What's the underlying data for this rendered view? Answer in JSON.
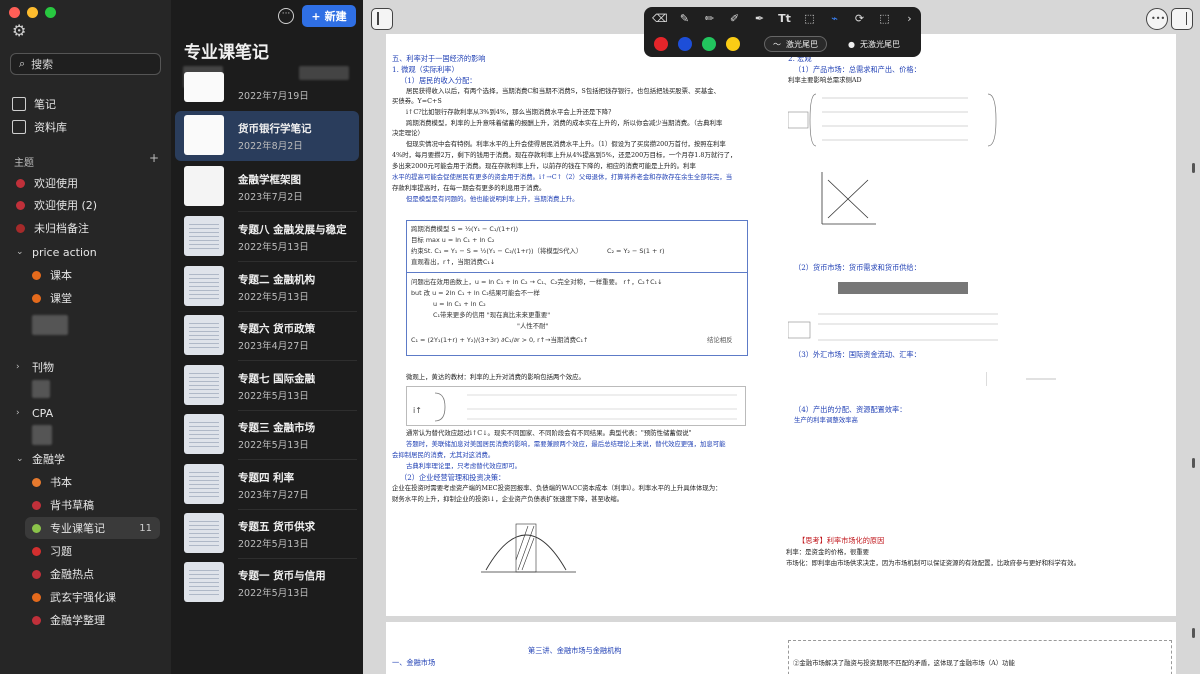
{
  "sidebar": {
    "search_placeholder": "搜索",
    "nav": {
      "notes": "笔记",
      "library": "资料库"
    },
    "section_title": "主题",
    "topics": [
      {
        "label": "欢迎使用",
        "color": "#c0303a"
      },
      {
        "label": "欢迎使用 (2)",
        "color": "#c0303a"
      },
      {
        "label": "未归档备注",
        "color": "#a52a2a"
      }
    ],
    "groups": [
      {
        "label": "price action",
        "expanded": true,
        "children": [
          {
            "label": "课本",
            "color": "#e46a1c"
          },
          {
            "label": "课堂",
            "color": "#e46a1c"
          }
        ]
      },
      {
        "label": "刊物",
        "expanded": false,
        "children": []
      },
      {
        "label": "CPA",
        "expanded": false,
        "children": []
      },
      {
        "label": "金融学",
        "expanded": true,
        "children": [
          {
            "label": "书本",
            "color": "#e67a2e"
          },
          {
            "label": "背书草稿",
            "color": "#c0303a"
          },
          {
            "label": "专业课笔记",
            "color": "#8bc34a",
            "count": "11",
            "active": true
          },
          {
            "label": "习题",
            "color": "#d32f2f"
          },
          {
            "label": "金融热点",
            "color": "#c0303a"
          },
          {
            "label": "武玄宇强化课",
            "color": "#e46a1c"
          },
          {
            "label": "金融学整理",
            "color": "#c0303a"
          }
        ]
      }
    ]
  },
  "notelist": {
    "title": "专业课笔记",
    "new_button": "新建",
    "notes": [
      {
        "title": "",
        "date": "2022年7月19日"
      },
      {
        "title": "货币银行学笔记",
        "date": "2022年8月2日"
      },
      {
        "title": "金融学框架图",
        "date": "2023年7月2日"
      },
      {
        "title": "专题八 金融发展与稳定",
        "date": "2022年5月13日"
      },
      {
        "title": "专题二 金融机构",
        "date": "2022年5月13日"
      },
      {
        "title": "专题六 货币政策",
        "date": "2023年4月27日"
      },
      {
        "title": "专题七 国际金融",
        "date": "2022年5月13日"
      },
      {
        "title": "专题三 金融市场",
        "date": "2022年5月13日"
      },
      {
        "title": "专题四 利率",
        "date": "2023年7月27日"
      },
      {
        "title": "专题五 货币供求",
        "date": "2022年5月13日"
      },
      {
        "title": "专题一 货币与信用",
        "date": "2022年5月13日"
      }
    ]
  },
  "toolbar": {
    "colors": [
      "#e5252a",
      "#1d4ed8",
      "#22c55e",
      "#facc15"
    ],
    "laser_tail": "激光尾巴",
    "no_laser_tail": "无激光尾巴"
  },
  "document": {
    "left": {
      "h1": "五、利率对于一国经济的影响",
      "h2": "1. 微观（实际利率）",
      "h3": "（1）居民的收入分配：",
      "p1": "居民获得收入以后，有两个选择，当期消费C和当期不消费S，S包括把钱存银行，也包括把钱买股票、买基金、",
      "p1b": "买债券。Y=C+S",
      "p2": "i↑C?比如银行存款利率从3%到4%，那么当期消费水平会上升还是下降？",
      "p3": "跨期消费模型，利率的上升意味着储蓄的报酬上升，消费的成本实在上升的，所以你会减少当期消费。（古典利率",
      "p3b": "决定理论）",
      "p4": "但现实情况中会有特例。利率水平的上升会使得居民消费水平上升。（1）假设为了买房攒200万首付，按照在利率",
      "p5": "4%时，每月要攒2万，剩下的钱用于消费。现在存款利率上升从4%提高到5%，还是200万目标，一个月存1.8万就行了，",
      "p6": "多出来2000元可能会用于消费。现在存款利率上升，以前存的钱在下降的，相应的消费可能是上升的。利率",
      "p7": "水平的提高可能会促使居民有更多的资金用于消费。i↑→C↑（2）父母退休，打算将养老金和存款存在余生全部花完，当",
      "p8": "存款利率提高时，在每一期会有更多的利息用于消费。",
      "p9": "但是模型是有问题的。他也能说明利率上升，当期消费上升。",
      "box1": "跨期消费模型  S = ½(Y₁ − C₁/(1+r))",
      "box2": "目标    max u = ln C₁ + ln C₂",
      "box3": "约束St.  C₁ = Y₁ − S = ½(Y₁ − C₂/(1+r))（将模型S代入）",
      "box3b": "C₂ = Y₂ − S(1 + r)",
      "box4": "直观看出，r↑，当期消费C₁↓",
      "box5": "问题出在效用函数上，u = ln C₁ + ln C₂ → C₁、C₂完全对称，一样重要。  r↑，C₂↑C₁↓",
      "box6": "but 改  u = 2ln C₁ + ln C₂结果可能会不一样",
      "box7": "u = ln C₁ + ln C₂",
      "box8": "C₁带来更多的信用 \"现在真比未来更重要\"",
      "box9": "\"人性不耐\"",
      "box10": "C₁ = (2Y₁(1+r) + Y₂)/(3+3r)    ∂C₁/∂r > 0,  r↑→当期消费C₁↑",
      "box_end": "结论相反",
      "p10": "微观上，黄达的教材：利率的上升对消费的影响包括两个效应。",
      "p11": "通常认为替代效应超过i↑C↓。现实不同国家、不同阶段会有不同结果。典型代表：\"预防性储蓄假说\"",
      "p12": "答题时，美联储加息对美国居民消费的影响，需要兼顾两个效应，最后总结理论上来说，替代效应更强，加息可能",
      "p13": "会抑制居民的消费，尤其对这消费。",
      "p14": "古典利率理论里，只考虑替代效应即可。",
      "h4": "（2）企业经营管理和投资决策：",
      "p15": "企业在投资时需要考虑资产端的MEC投资回报率、负债端的WACC资本成本（利率i）。利率水平的上升具体体现为：",
      "p16": "财务水平的上升，抑制企业的投资i↓，企业资产负债表扩张速度下降，甚至收缩。"
    },
    "right": {
      "h1": "2. 宏观",
      "h2": "（1）产品市场：总需求和产出、价格：",
      "p1": "利率主要影响总需求侧AD",
      "h3": "（2）货币市场：货币需求和货币供给：",
      "h4": "（3）外汇市场：国际资金流动、汇率：",
      "h5": "（4）产出的分配、资源配置效率：",
      "h5b": "生产的利率调整效率高",
      "p_end1": "利率：是资金的价格，很重要",
      "p_end2": "市场化：即利率由市场供求决定，因为市场机制可以保证资源的有效配置，比政府参与更好和科学有效。",
      "think": "【思考】利率市场化的原因"
    },
    "page2_left_title": "第三讲、金融市场与金融机构",
    "page2_left_h": "一、金融市场",
    "page2_right": "②金融市场解决了融资与投资期限不匹配的矛盾，这体现了金融市场（A）功能"
  }
}
